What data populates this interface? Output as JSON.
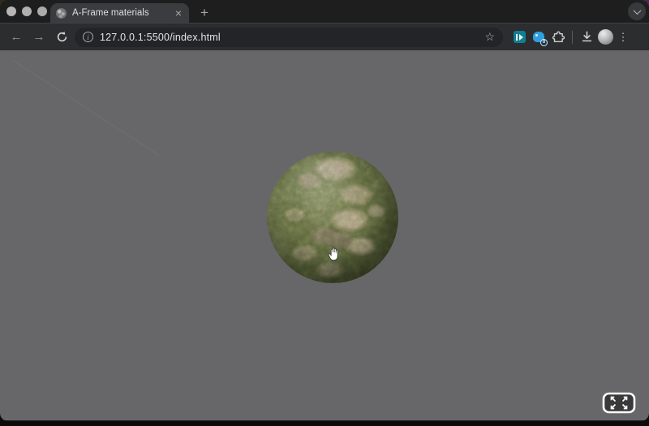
{
  "browser": {
    "tab_title": "A-Frame materials",
    "url": "127.0.0.1:5500/index.html",
    "extension_badge": "0",
    "icons": {
      "back": "←",
      "forward": "→",
      "bookmark": "☆",
      "menu": "⋮",
      "new_tab": "+",
      "close_tab": "×",
      "site_info": "i"
    },
    "window_controls": [
      "close",
      "minimize",
      "zoom"
    ]
  },
  "page": {
    "description": "A-Frame 3D scene: moss and dirt textured sphere centered on flat gray background",
    "background_color": "#67676a",
    "cursor": "open-hand-grab",
    "vr_button": "enter-fullscreen-arrows"
  },
  "colors": {
    "tabstrip_bg": "#1e1e1f",
    "active_tab_bg": "#3b3c3f",
    "toolbar_bg": "#2c2d2f",
    "omnibox_bg": "#232427",
    "extension_teal": "#0e7f94",
    "extension_blue": "#2f9fe0",
    "sphere_moss_green": "#5a6339",
    "sphere_dirt_tan": "#a0917a"
  }
}
